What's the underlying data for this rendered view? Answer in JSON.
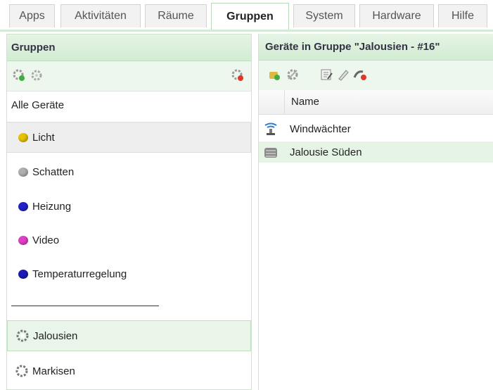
{
  "tabs": [
    {
      "label": "Apps",
      "active": false
    },
    {
      "label": "Aktivitäten",
      "active": false
    },
    {
      "label": "Räume",
      "active": false
    },
    {
      "label": "Gruppen",
      "active": true
    },
    {
      "label": "System",
      "active": false
    },
    {
      "label": "Hardware",
      "active": false
    },
    {
      "label": "Hilfe",
      "active": false
    }
  ],
  "left_panel": {
    "title": "Gruppen",
    "all_devices": "Alle Geräte",
    "groups": [
      {
        "label": "Licht",
        "color": "#e8c400",
        "selected": true
      },
      {
        "label": "Schatten",
        "color": "#b0b0b0"
      },
      {
        "label": "Heizung",
        "color": "#2323c8"
      },
      {
        "label": "Video",
        "color": "#e040c8"
      },
      {
        "label": "Temperaturregelung",
        "color": "#1c1cb4"
      }
    ],
    "device_groups": [
      {
        "label": "Jalousien",
        "icon": "gear-icon",
        "selected": true
      },
      {
        "label": "Markisen",
        "icon": "gear-icon"
      }
    ]
  },
  "right_panel": {
    "title": "Geräte in Gruppe \"Jalousien - #16\"",
    "column_name": "Name",
    "rows": [
      {
        "label": "Windwächter",
        "icon": "wind-sensor-icon"
      },
      {
        "label": "Jalousie Süden",
        "icon": "blind-icon",
        "highlighted": true
      }
    ]
  },
  "colors": {
    "header_green": "#d2ebd2",
    "selection_green": "#e5f4e5"
  }
}
